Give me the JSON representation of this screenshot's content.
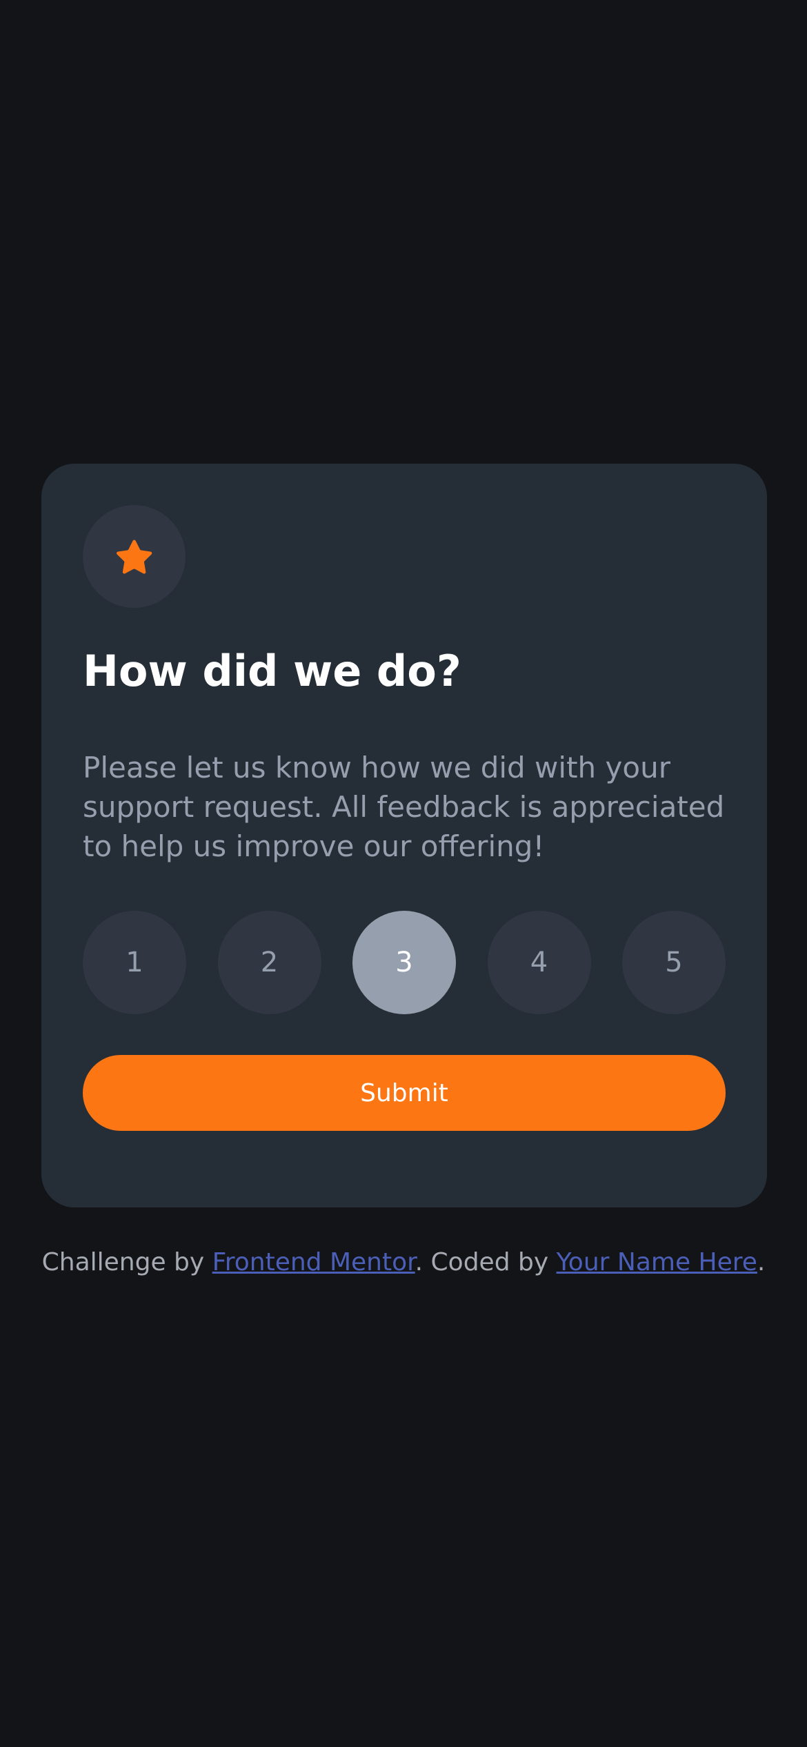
{
  "card": {
    "icon": "star-icon",
    "title": "How did we do?",
    "description": "Please let us know how we did with your support request. All feedback is appreciated to help us improve our offering!",
    "ratings": [
      "1",
      "2",
      "3",
      "4",
      "5"
    ],
    "selected_rating": "3",
    "submit_label": "Submit"
  },
  "footer": {
    "prefix": "Challenge by ",
    "link1_text": "Frontend Mentor",
    "middle": ". Coded by ",
    "link2_text": "Your Name Here",
    "suffix": "."
  },
  "colors": {
    "background": "#121417",
    "card": "#252d37",
    "accent": "#fc7614",
    "muted": "#969fad",
    "link": "#4c5fb8"
  }
}
